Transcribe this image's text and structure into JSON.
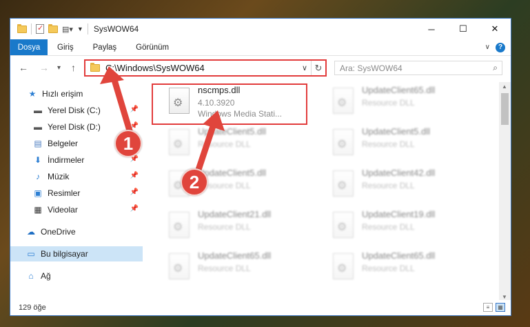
{
  "window": {
    "title": "SysWOW64",
    "minimize": "─",
    "maximize": "☐",
    "close": "✕"
  },
  "ribbon": {
    "tabs": [
      "Dosya",
      "Giriş",
      "Paylaş",
      "Görünüm"
    ],
    "expand_icon": "chevron-down-icon",
    "help_label": "?"
  },
  "nav": {
    "back": "←",
    "forward": "→",
    "recent": "▾",
    "up": "↑",
    "address": "C:\\Windows\\SysWOW64",
    "search_placeholder": "Ara: SysWOW64"
  },
  "sidebar": {
    "items": [
      {
        "label": "Hızlı erişim",
        "icon": "star-icon",
        "glyph": "★",
        "color": "#2d7fd3"
      },
      {
        "label": "Yerel Disk (C:)",
        "icon": "drive-icon",
        "glyph": "▬",
        "color": "#555555"
      },
      {
        "label": "Yerel Disk (D:)",
        "icon": "drive-icon",
        "glyph": "▬",
        "color": "#555555"
      },
      {
        "label": "Belgeler",
        "icon": "document-icon",
        "glyph": "▤",
        "color": "#4a7bc0"
      },
      {
        "label": "İndirmeler",
        "icon": "download-icon",
        "glyph": "⬇",
        "color": "#2d7fd3"
      },
      {
        "label": "Müzik",
        "icon": "music-icon",
        "glyph": "♪",
        "color": "#2d7fd3"
      },
      {
        "label": "Resimler",
        "icon": "pictures-icon",
        "glyph": "▣",
        "color": "#2d7fd3"
      },
      {
        "label": "Videolar",
        "icon": "video-icon",
        "glyph": "▦",
        "color": "#333333"
      },
      {
        "label": "OneDrive",
        "icon": "cloud-icon",
        "glyph": "☁",
        "color": "#1f6fc4"
      },
      {
        "label": "Bu bilgisayar",
        "icon": "computer-icon",
        "glyph": "▭",
        "color": "#2d7fd3"
      },
      {
        "label": "Ağ",
        "icon": "network-icon",
        "glyph": "⌂",
        "color": "#2d7fd3"
      }
    ]
  },
  "files": [
    {
      "name": "nscmps.dll",
      "line2": "4.10.3920",
      "line3": "Windows Media Stati...",
      "blurred": false
    },
    {
      "name": "UpdateClient65.dll",
      "line2": "Resource DLL",
      "blurred": true
    },
    {
      "name": "UpdateClient5.dll",
      "line2": "Resource DLL",
      "blurred": true
    },
    {
      "name": "UpdateClient5.dll",
      "line2": "Resource DLL",
      "blurred": true
    },
    {
      "name": "UpdateClient5.dll",
      "line2": "Resource DLL",
      "blurred": true
    },
    {
      "name": "UpdateClient42.dll",
      "line2": "Resource DLL",
      "blurred": true
    },
    {
      "name": "UpdateClient21.dll",
      "line2": "Resource DLL",
      "blurred": true
    },
    {
      "name": "UpdateClient19.dll",
      "line2": "Resource DLL",
      "blurred": true
    },
    {
      "name": "UpdateClient65.dll",
      "line2": "Resource DLL",
      "blurred": true
    },
    {
      "name": "UpdateClient65.dll",
      "line2": "Resource DLL",
      "blurred": true
    }
  ],
  "status": {
    "count": "129 öğe"
  },
  "annotations": {
    "step1": "1",
    "step2": "2",
    "color": "#e0453c"
  }
}
